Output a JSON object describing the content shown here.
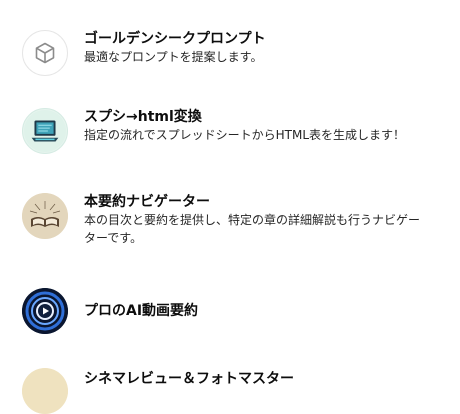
{
  "gpts": [
    {
      "title": "ゴールデンシークプロンプト",
      "description": "最適なプロンプトを提案します。",
      "icon": "cube-icon"
    },
    {
      "title": "スプシ→html変換",
      "description": "指定の流れでスプレッドシートからHTML表を生成します！",
      "icon": "laptop-icon"
    },
    {
      "title": "本要約ナビゲーター",
      "description": "本の目次と要約を提供し、特定の章の詳細解説も行うナビゲーターです。",
      "icon": "book-icon"
    },
    {
      "title": "プロのAI動画要約",
      "description": "",
      "icon": "play-icon"
    },
    {
      "title": "シネマレビュー＆フォトマスター",
      "description": "",
      "icon": "cinema-icon"
    }
  ]
}
